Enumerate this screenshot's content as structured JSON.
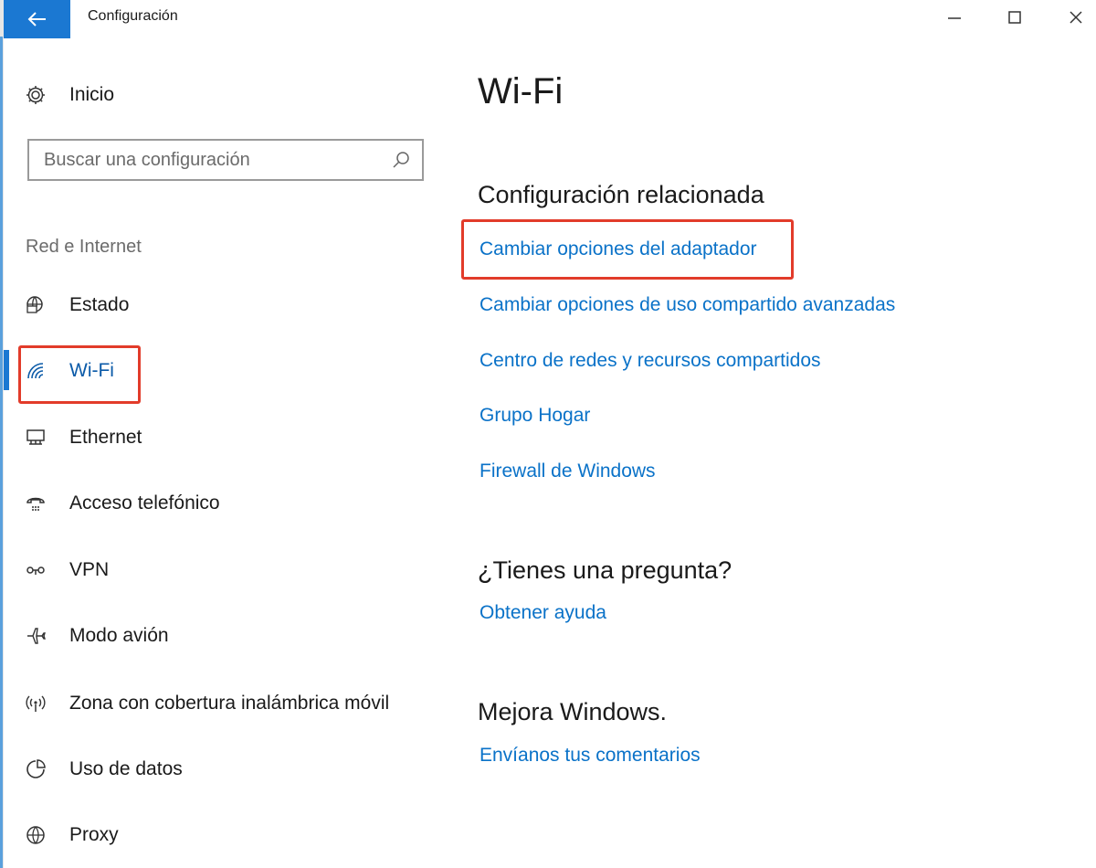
{
  "window": {
    "title": "Configuración"
  },
  "sidebar": {
    "home_label": "Inicio",
    "search_placeholder": "Buscar una configuración",
    "section_label": "Red e Internet",
    "items": [
      {
        "label": "Estado",
        "icon": "globe-status-icon"
      },
      {
        "label": "Wi-Fi",
        "icon": "wifi-icon",
        "active": true
      },
      {
        "label": "Ethernet",
        "icon": "ethernet-icon"
      },
      {
        "label": "Acceso telefónico",
        "icon": "dialup-icon"
      },
      {
        "label": "VPN",
        "icon": "vpn-icon"
      },
      {
        "label": "Modo avión",
        "icon": "airplane-icon"
      },
      {
        "label": "Zona con cobertura inalámbrica móvil",
        "icon": "hotspot-icon"
      },
      {
        "label": "Uso de datos",
        "icon": "data-usage-icon"
      },
      {
        "label": "Proxy",
        "icon": "globe-icon"
      }
    ]
  },
  "main": {
    "title": "Wi-Fi",
    "related_heading": "Configuración relacionada",
    "related_links": [
      "Cambiar opciones del adaptador",
      "Cambiar opciones de uso compartido avanzadas",
      "Centro de redes y recursos compartidos",
      "Grupo Hogar",
      "Firewall de Windows"
    ],
    "question_heading": "¿Tienes una pregunta?",
    "help_link": "Obtener ayuda",
    "improve_heading": "Mejora Windows.",
    "feedback_link": "Envíanos tus comentarios"
  },
  "colors": {
    "accent": "#1b78d2",
    "link": "#0a72c8",
    "highlight": "#e23b2a"
  }
}
